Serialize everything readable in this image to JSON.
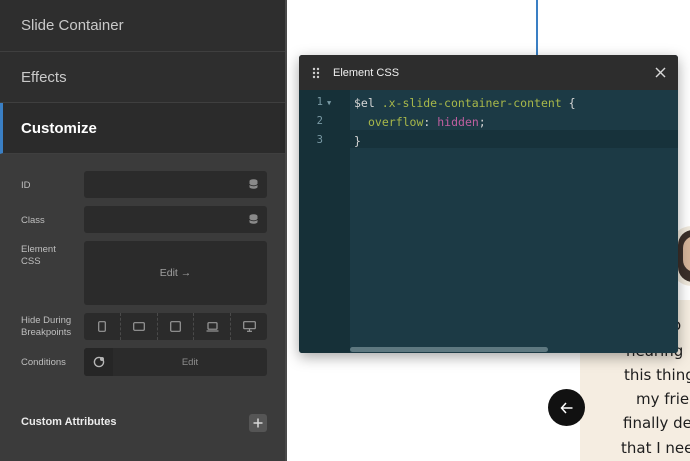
{
  "panel": {
    "sections": [
      "Slide Container",
      "Effects",
      "Customize"
    ],
    "fields": {
      "id_label": "ID",
      "class_label": "Class",
      "element_css_label": "Element CSS",
      "element_css_button": "Edit →",
      "hide_breakpoints_label": "Hide During Breakpoints",
      "conditions_label": "Conditions",
      "conditions_button": "Edit"
    },
    "custom_attributes": "Custom Attributes"
  },
  "editor": {
    "title": "Element CSS",
    "line_numbers": [
      "1",
      "2",
      "3"
    ],
    "code": {
      "l1_var": "$el",
      "l1_sel": " .x-slide-container-content",
      "l1_brace": " {",
      "l2_prop": "overflow",
      "l2_colon": ": ",
      "l2_val": "hidden",
      "l2_semi": ";",
      "l3_brace": "}"
    }
  },
  "canvas": {
    "quote_lines": [
      "o",
      "hearing",
      "this thing",
      "my frie",
      "finally de",
      "that I nee"
    ]
  },
  "colors": {
    "accent": "#3a7fc4",
    "panel_bg": "#333333",
    "editor_bg": "#1c3a45"
  }
}
